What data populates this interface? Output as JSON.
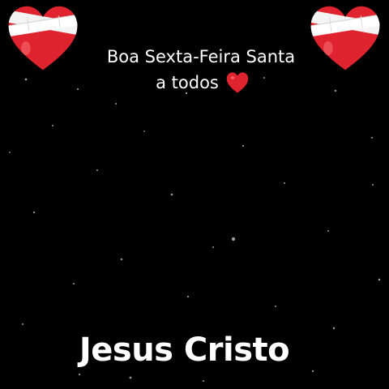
{
  "greeting": {
    "line1": "Boa Sexta-Feira Santa",
    "line2": "a todos"
  },
  "title": "Jesus Cristo",
  "icons": {
    "top_left": "bandaged-heart-icon",
    "top_right": "bandaged-heart-icon",
    "inline": "red-heart-icon"
  },
  "colors": {
    "background": "#000000",
    "text": "#ffffff",
    "heart_red": "#e0242f"
  }
}
